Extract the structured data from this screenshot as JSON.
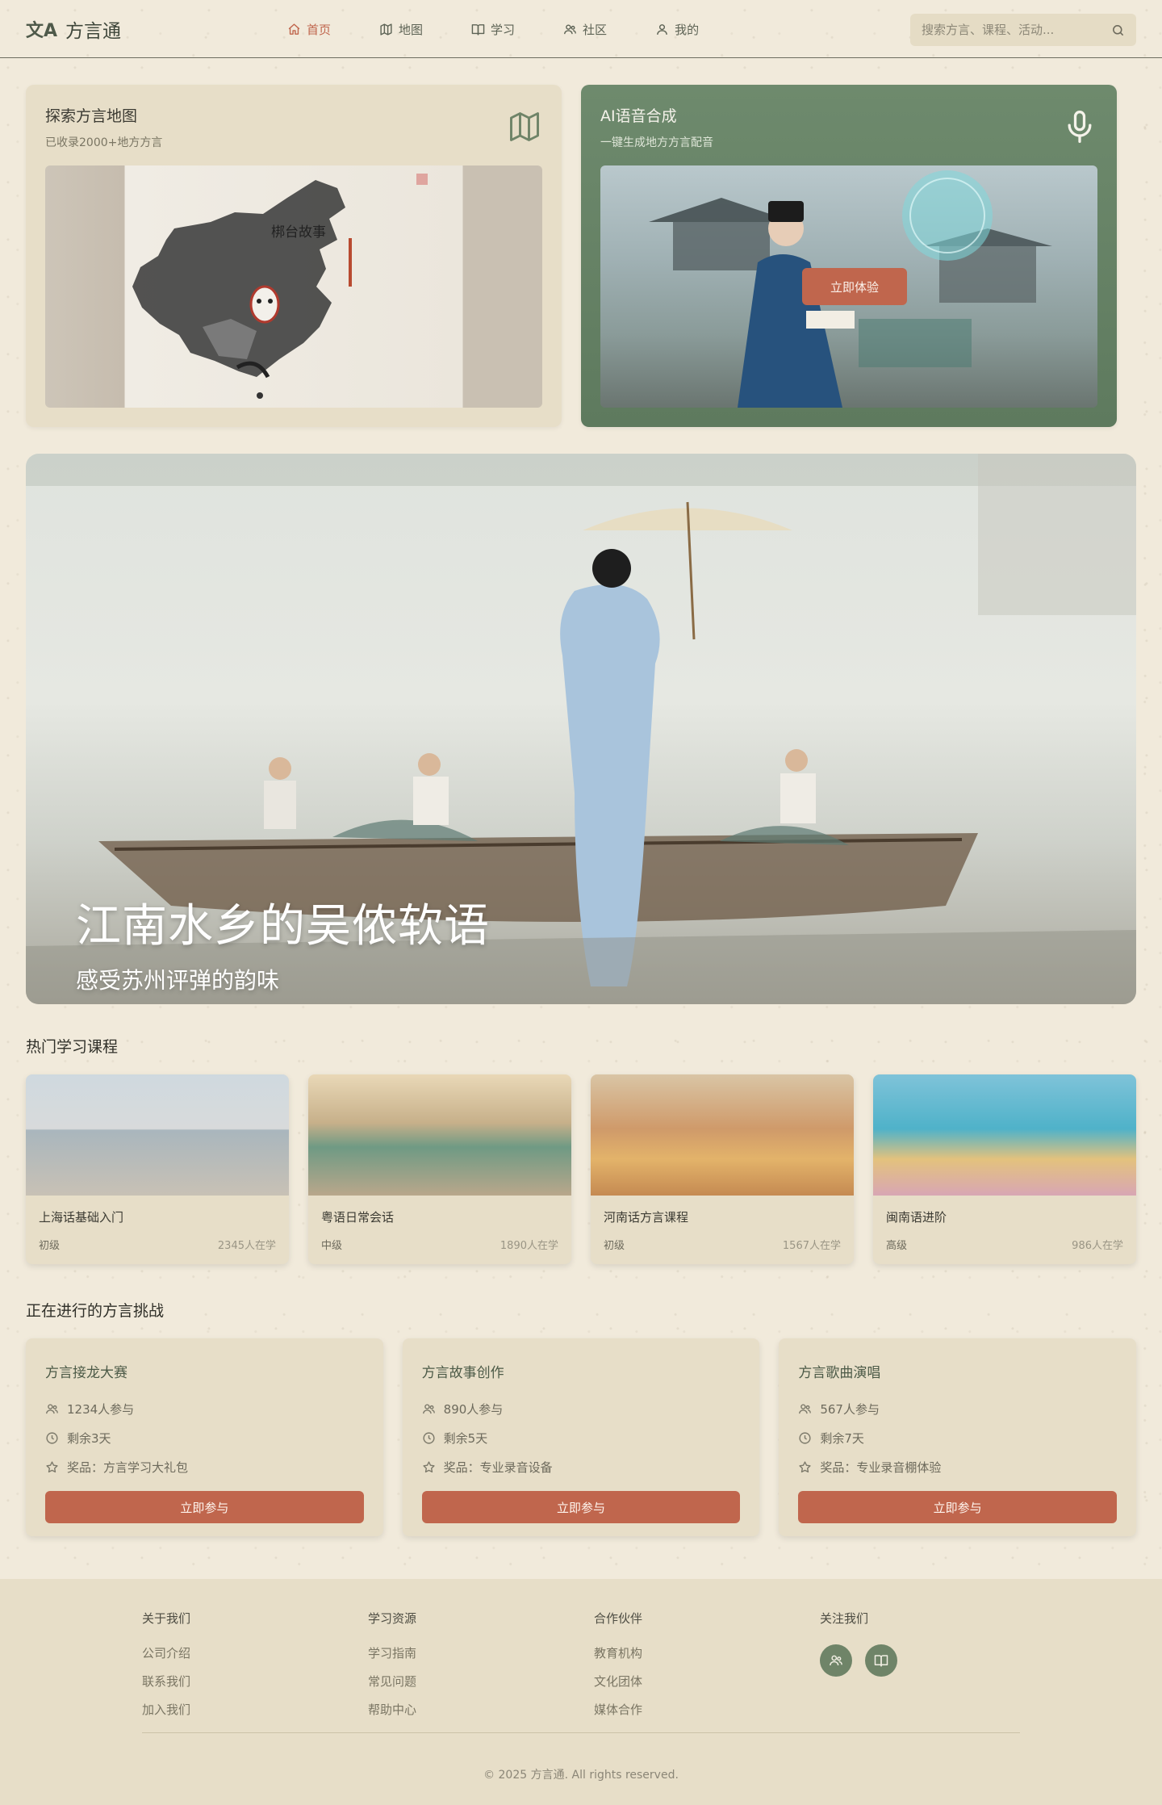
{
  "header": {
    "logo_glyph": "文A",
    "app_name": "方言通",
    "nav": [
      {
        "label": "首页",
        "icon": "home-icon",
        "active": true
      },
      {
        "label": "地图",
        "icon": "map-icon",
        "active": false
      },
      {
        "label": "学习",
        "icon": "book-icon",
        "active": false
      },
      {
        "label": "社区",
        "icon": "users-icon",
        "active": false
      },
      {
        "label": "我的",
        "icon": "user-icon",
        "active": false
      }
    ],
    "search_placeholder": "搜索方言、课程、活动..."
  },
  "features": {
    "map": {
      "title": "探索方言地图",
      "subtitle": "已收录2000+地方方言",
      "image_text": "梆台故事",
      "icon": "map-icon"
    },
    "ai": {
      "title": "AI语音合成",
      "subtitle": "一键生成地方方言配音",
      "button": "立即体验",
      "icon": "microphone-icon"
    }
  },
  "hero": {
    "title": "江南水乡的吴侬软语",
    "subtitle": "感受苏州评弹的韵味"
  },
  "courses_section": {
    "title": "热门学习课程",
    "items": [
      {
        "name": "上海话基础入门",
        "level": "初级",
        "learners": "2345人在学"
      },
      {
        "name": "粤语日常会话",
        "level": "中级",
        "learners": "1890人在学"
      },
      {
        "name": "河南话方言课程",
        "level": "初级",
        "learners": "1567人在学"
      },
      {
        "name": "闽南语进阶",
        "level": "高级",
        "learners": "986人在学"
      }
    ]
  },
  "challenges_section": {
    "title": "正在进行的方言挑战",
    "items": [
      {
        "title": "方言接龙大赛",
        "participants": "1234人参与",
        "remaining": "剩余3天",
        "prize": "奖品：方言学习大礼包",
        "button": "立即参与"
      },
      {
        "title": "方言故事创作",
        "participants": "890人参与",
        "remaining": "剩余5天",
        "prize": "奖品：专业录音设备",
        "button": "立即参与"
      },
      {
        "title": "方言歌曲演唱",
        "participants": "567人参与",
        "remaining": "剩余7天",
        "prize": "奖品：专业录音棚体验",
        "button": "立即参与"
      }
    ]
  },
  "footer": {
    "columns": [
      {
        "title": "关于我们",
        "links": [
          "公司介绍",
          "联系我们",
          "加入我们"
        ]
      },
      {
        "title": "学习资源",
        "links": [
          "学习指南",
          "常见问题",
          "帮助中心"
        ]
      },
      {
        "title": "合作伙伴",
        "links": [
          "教育机构",
          "文化团体",
          "媒体合作"
        ]
      }
    ],
    "social_title": "关注我们",
    "socials": [
      "users-icon",
      "book-icon"
    ],
    "copyright": "© 2025 方言通. All rights reserved."
  },
  "colors": {
    "accent": "#c0664d",
    "green": "#6f8468",
    "paper": "#f1eadb",
    "card": "#e7dec8"
  }
}
